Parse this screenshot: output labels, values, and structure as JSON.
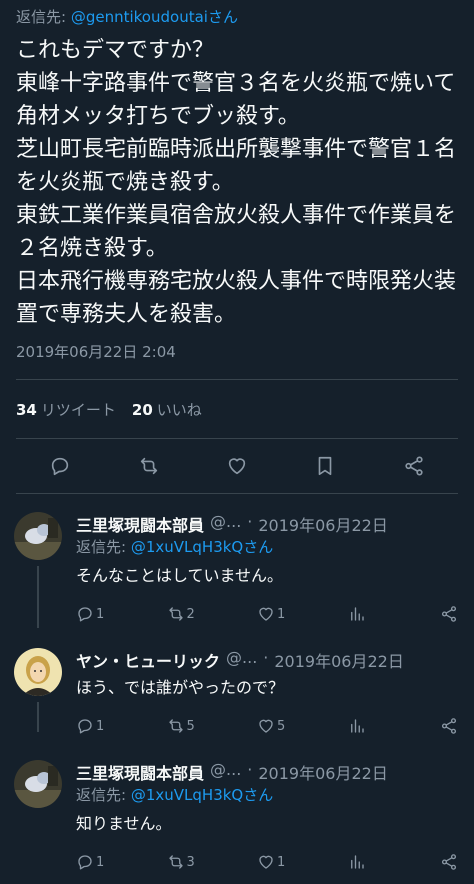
{
  "main_tweet": {
    "reply_prefix": "返信先:",
    "reply_handle": "@genntikoudoutaiさん",
    "text": "これもデマですか？\n東峰十字路事件で警官３名を火炎瓶で焼いて角材メッタ打ちでブッ殺す。\n芝山町長宅前臨時派出所襲撃事件で警官１名を火炎瓶で焼き殺す。\n東鉄工業作業員宿舎放火殺人事件で作業員を２名焼き殺す。\n日本飛行機専務宅放火殺人事件で時限発火装置で専務夫人を殺害。",
    "timestamp": "2019年06月22日 2:04",
    "retweets_count": "34",
    "retweets_label": "リツイート",
    "likes_count": "20",
    "likes_label": "いいね"
  },
  "action_icons": [
    "reply-icon",
    "retweet-icon",
    "like-icon",
    "bookmark-icon",
    "share-icon"
  ],
  "replies": [
    {
      "name": "三里塚現闘本部員",
      "handle": "@...",
      "dot": "·",
      "date": "2019年06月22日",
      "reply_prefix": "返信先:",
      "reply_handle": "@1xuVLqH3kQさん",
      "text": "そんなことはしていません。",
      "reply_count": "1",
      "retweet_count": "2",
      "like_count": "1"
    },
    {
      "name": "ヤン・ヒューリック",
      "handle": "@...",
      "dot": "·",
      "date": "2019年06月22日",
      "text": "ほう、では誰がやったので？",
      "reply_count": "1",
      "retweet_count": "5",
      "like_count": "5"
    },
    {
      "name": "三里塚現闘本部員",
      "handle": "@...",
      "dot": "·",
      "date": "2019年06月22日",
      "reply_prefix": "返信先:",
      "reply_handle": "@1xuVLqH3kQさん",
      "text": "知りません。",
      "reply_count": "1",
      "retweet_count": "3",
      "like_count": "1"
    }
  ],
  "colors": {
    "background": "#15202b",
    "text": "#f7f9f9",
    "muted": "#8b98a5",
    "link": "#1d9bf0",
    "divider": "#38444d"
  }
}
